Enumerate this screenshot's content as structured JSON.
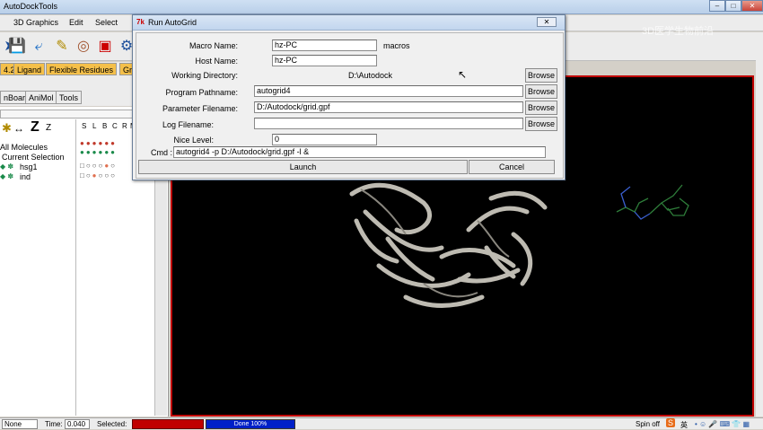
{
  "app": {
    "title": "AutoDockTools",
    "controls": [
      "–",
      "□",
      "✕"
    ]
  },
  "menu": [
    "3D Graphics",
    "Edit",
    "Select"
  ],
  "tabs": [
    "4.2",
    "Ligand",
    "Flexible Residues",
    "Gr"
  ],
  "tabs2": [
    "nBoard",
    "AniMol",
    "Tools"
  ],
  "panel": {
    "toolbar_glyphs": [
      "✱",
      "↔",
      "Z",
      "Z"
    ],
    "col_headers": [
      "S",
      "L",
      "B",
      "C",
      "R",
      "M"
    ],
    "items": [
      "All Molecules",
      "Current Selection",
      "hsg1",
      "ind"
    ]
  },
  "dialog": {
    "title": "Run AutoGrid",
    "close": "✕",
    "macro_label": "Macro Name:",
    "macro_value": "hz-PC",
    "macro_suffix": "macros",
    "host_label": "Host Name:",
    "host_value": "hz-PC",
    "wd_label": "Working Directory:",
    "wd_value": "D:\\Autodock",
    "prog_label": "Program Pathname:",
    "prog_value": "autogrid4",
    "param_label": "Parameter Filename:",
    "param_value": "D:/Autodock/grid.gpf",
    "log_label": "Log Filename:",
    "log_value": "",
    "nice_label": "Nice Level:",
    "nice_value": "0",
    "cmd_label": "Cmd :",
    "cmd_value": "autogrid4 -p D:/Autodock/grid.gpf -l  &",
    "browse": "Browse",
    "launch": "Launch",
    "cancel": "Cancel"
  },
  "status": {
    "none": "None",
    "time_label": "Time:",
    "time_value": "0.040",
    "selected_label": "Selected:",
    "progress_text": "Done 100%",
    "progress": 1.0,
    "spin": "Spin off"
  },
  "overlay": {
    "watermark": "3D医学生物前沿",
    "ime": "英"
  },
  "colors": {
    "viewer_bg": "#000000",
    "viewer_border": "#c00000",
    "progress_fill": "#0020c8",
    "selected_fill": "#c00000"
  }
}
